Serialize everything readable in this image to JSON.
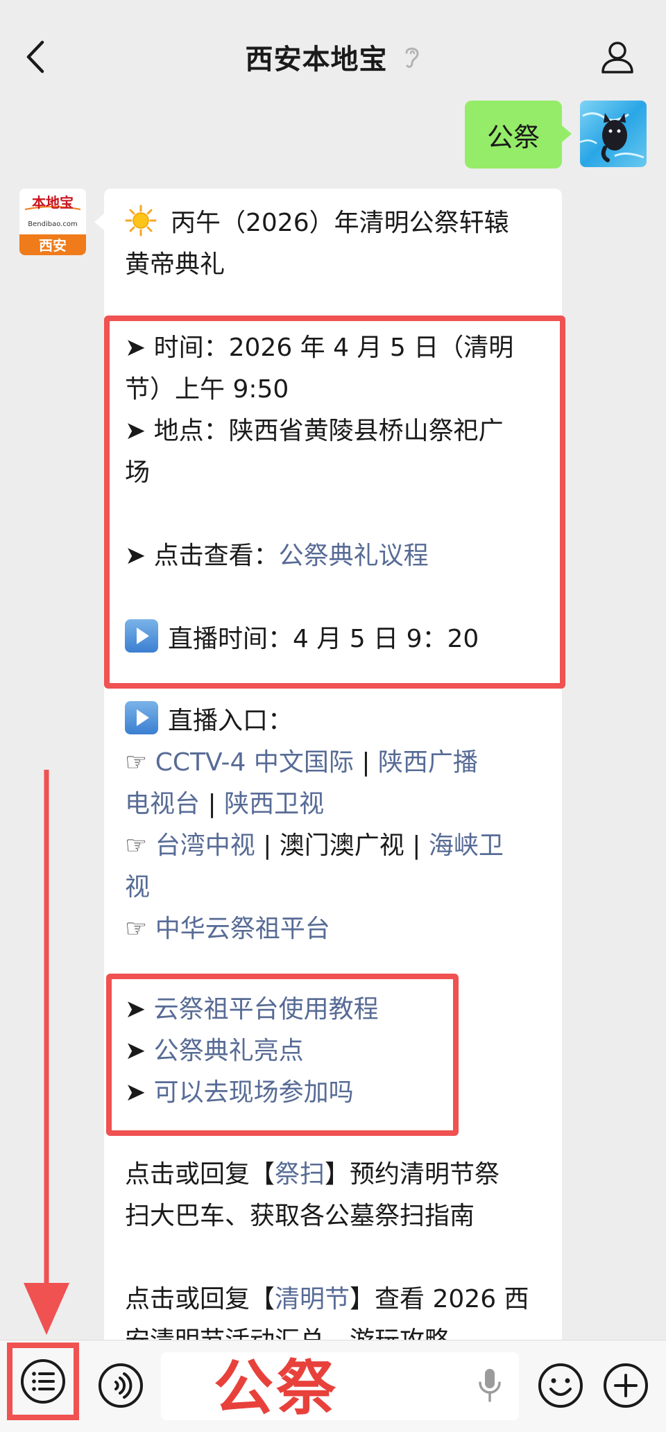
{
  "header": {
    "title": "西安本地宝",
    "back_icon": "chevron-left-icon",
    "mute_icon": "ear-icon",
    "profile_icon": "person-icon"
  },
  "sent": {
    "text": "公祭"
  },
  "bot": {
    "logo_top": "本地宝",
    "logo_site": "Bendibao.com",
    "logo_city": "西安",
    "headline_line1": "丙午（2026）年清明公祭轩辕",
    "headline_line2": "黄帝典礼",
    "time_line1": "➤ 时间：2026 年 4 月 5 日（清明",
    "time_line2": "节）上午 9:50",
    "place_line1": "➤ 地点：陕西省黄陵县桥山祭祀广",
    "place_line2": "场",
    "view_prefix": "➤ 点击查看：",
    "view_link": "公祭典礼议程",
    "live_time": "直播时间：4 月 5 日 9：20",
    "live_entry": "直播入口：",
    "hand_glyph": "☞",
    "bar": "|",
    "ch_cctv4": "CCTV-4 中文国际",
    "ch_sx_tv_part1": "陕西广播",
    "ch_sx_tv_part2": "电视台",
    "ch_sx_ws": "陕西卫视",
    "ch_tw": "台湾中视",
    "ch_macau": "澳门澳广视",
    "ch_hx_part1": "海峡卫",
    "ch_hx_part2": "视",
    "ch_cloud": "中华云祭祖平台",
    "arrow_glyph": "➤",
    "tut": "云祭祖平台使用教程",
    "highlights": "公祭典礼亮点",
    "visit": "可以去现场参加吗",
    "reply1_prefix": "点击或回复【",
    "reply1_link": "祭扫",
    "reply1_suffix": "】预约清明节祭",
    "reply1_line2": "扫大巴车、获取各公墓祭扫指南",
    "reply2_prefix": "点击或回复【",
    "reply2_link": "清明节",
    "reply2_suffix": "】查看 2026 西",
    "reply2_line2": "安清明节活动汇总、游玩攻略"
  },
  "input": {
    "text": "公祭"
  },
  "colors": {
    "link": "#576b95",
    "highlight": "#f05151",
    "sent_bubble": "#95ec69",
    "background": "#ededed"
  }
}
